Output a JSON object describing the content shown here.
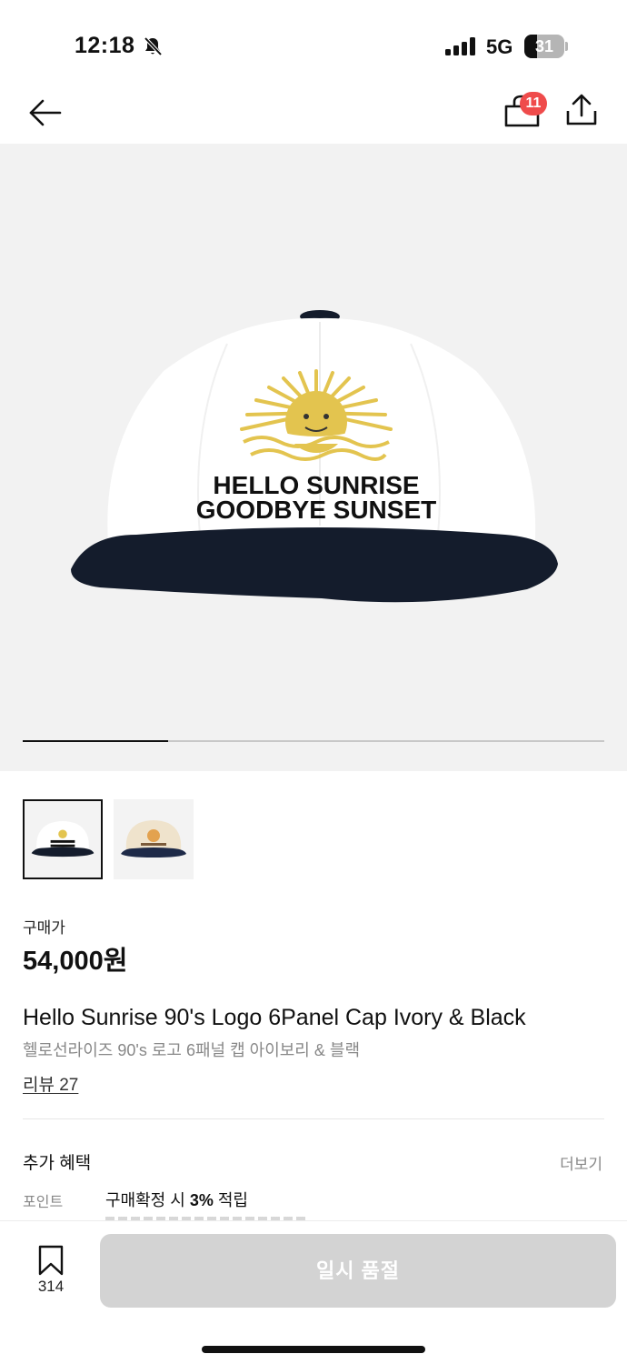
{
  "status_bar": {
    "time": "12:18",
    "network": "5G",
    "battery_level": "31",
    "battery_fraction": 0.31,
    "icons": [
      "bell-slash-icon",
      "signal-icon",
      "battery-icon"
    ]
  },
  "nav": {
    "cart_count": "11",
    "icons": [
      "back-arrow-icon",
      "shopping-bag-icon",
      "share-icon"
    ]
  },
  "gallery": {
    "cap_text_line1": "HELLO SUNRISE",
    "cap_text_line2": "GOODBYE SUNSET",
    "progress_fraction": 0.25,
    "selected_thumbnail": 1,
    "thumbnail_count": 2
  },
  "product": {
    "price_label": "구매가",
    "price": "54,000원",
    "name_en": "Hello Sunrise 90's Logo 6Panel Cap Ivory & Black",
    "name_ko": "헬로선라이즈 90's 로고 6패널 캡 아이보리 & 블랙",
    "review_link": "리뷰 27"
  },
  "benefits": {
    "title": "추가 혜택",
    "more": "더보기",
    "point_label": "포인트",
    "point_desc_prefix": "구매확정 시 ",
    "point_rate": "3%",
    "point_desc_suffix": " 적립"
  },
  "bottom_bar": {
    "bookmark_count": "314",
    "buy_button": "일시 품절"
  },
  "colors": {
    "badge": "#ef4b4b",
    "disabled_button": "#d3d3d3",
    "image_bg": "#f2f2f2",
    "cap_navy": "#141c2c",
    "sun_gold": "#e3c44f"
  }
}
